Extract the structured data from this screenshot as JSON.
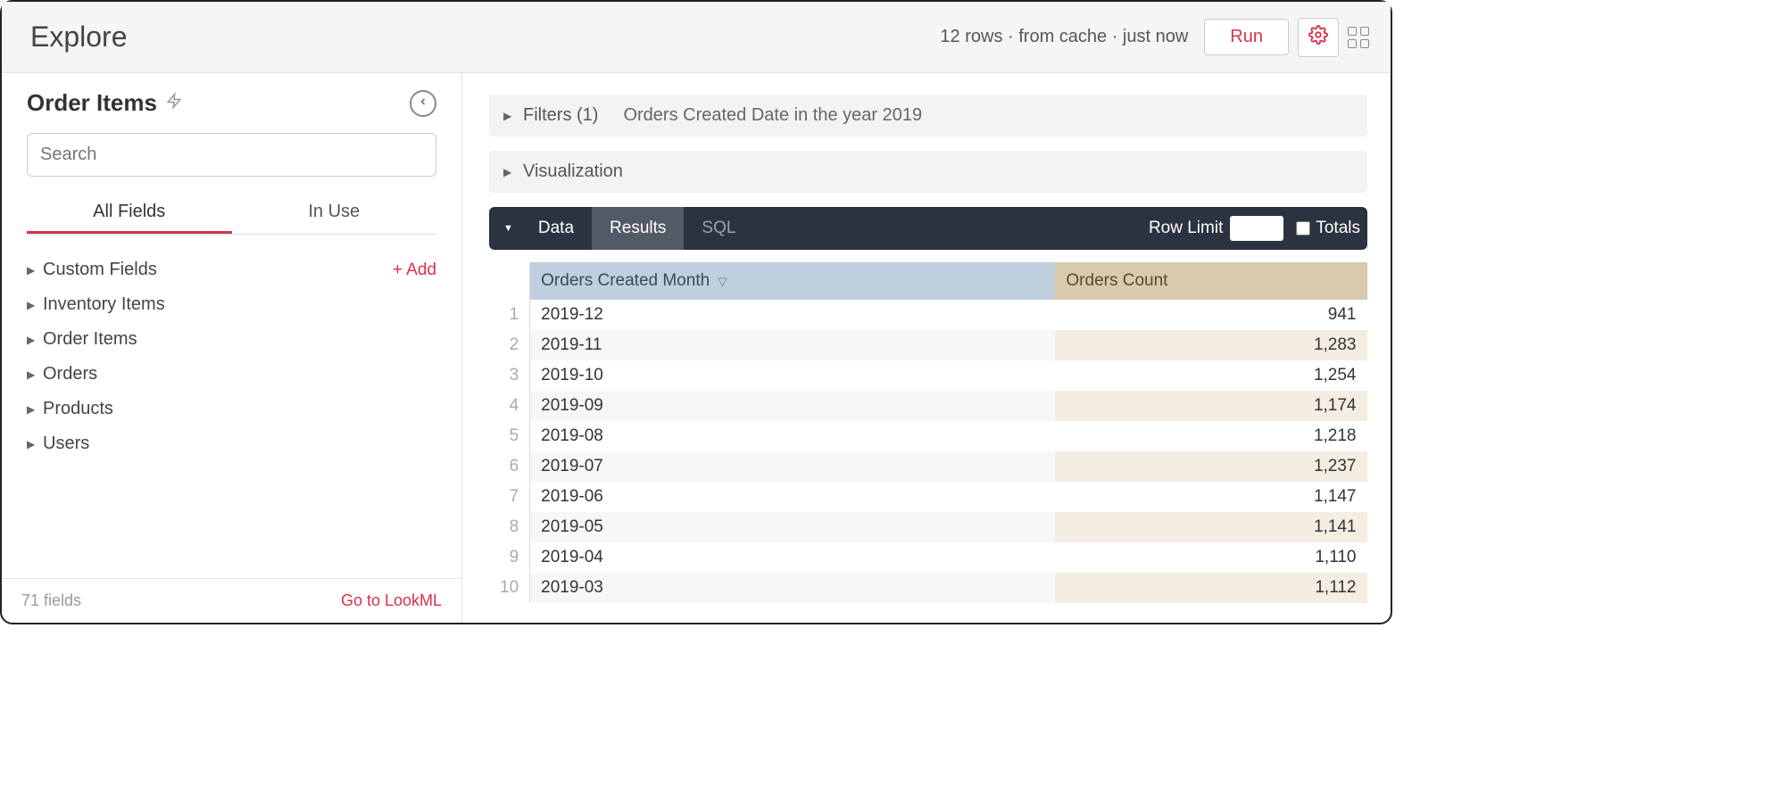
{
  "header": {
    "title": "Explore",
    "status": "12 rows  ·  from cache  ·  just now",
    "run": "Run"
  },
  "sidebar": {
    "title": "Order Items",
    "search_placeholder": "Search",
    "tabs": {
      "all": "All Fields",
      "in_use": "In Use"
    },
    "add_label": "+  Add",
    "groups": [
      {
        "label": "Custom Fields",
        "has_add": true
      },
      {
        "label": "Inventory Items",
        "has_add": false
      },
      {
        "label": "Order Items",
        "has_add": false
      },
      {
        "label": "Orders",
        "has_add": false
      },
      {
        "label": "Products",
        "has_add": false
      },
      {
        "label": "Users",
        "has_add": false
      }
    ],
    "footer_count": "71 fields",
    "footer_link": "Go to LookML"
  },
  "panels": {
    "filters_label": "Filters (1)",
    "filters_text": "Orders Created Date in the year 2019",
    "viz_label": "Visualization"
  },
  "databar": {
    "data": "Data",
    "results": "Results",
    "sql": "SQL",
    "row_limit": "Row Limit",
    "totals": "Totals"
  },
  "table": {
    "col_dim": "Orders Created Month",
    "col_meas": "Orders Count",
    "rows": [
      {
        "n": "1",
        "month": "2019-12",
        "count": "941"
      },
      {
        "n": "2",
        "month": "2019-11",
        "count": "1,283"
      },
      {
        "n": "3",
        "month": "2019-10",
        "count": "1,254"
      },
      {
        "n": "4",
        "month": "2019-09",
        "count": "1,174"
      },
      {
        "n": "5",
        "month": "2019-08",
        "count": "1,218"
      },
      {
        "n": "6",
        "month": "2019-07",
        "count": "1,237"
      },
      {
        "n": "7",
        "month": "2019-06",
        "count": "1,147"
      },
      {
        "n": "8",
        "month": "2019-05",
        "count": "1,141"
      },
      {
        "n": "9",
        "month": "2019-04",
        "count": "1,110"
      },
      {
        "n": "10",
        "month": "2019-03",
        "count": "1,112"
      }
    ]
  }
}
